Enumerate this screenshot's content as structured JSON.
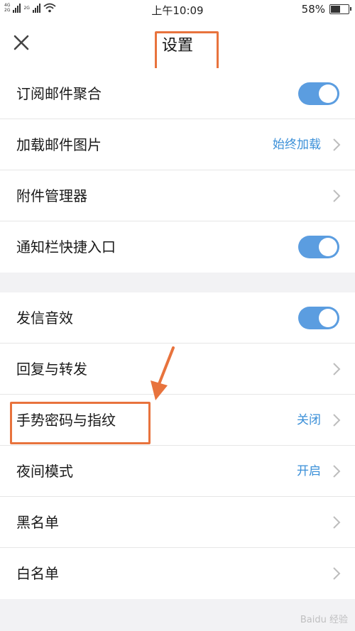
{
  "status_bar": {
    "net1": "4G",
    "net2": "2G",
    "net3": "2G",
    "time": "上午10:09",
    "battery": "58%",
    "battery_level": 0.58
  },
  "header": {
    "title": "设置"
  },
  "rows": [
    {
      "label": "订阅邮件聚合",
      "toggle": true
    },
    {
      "label": "加载邮件图片",
      "value": "始终加载"
    },
    {
      "label": "附件管理器"
    },
    {
      "label": "通知栏快捷入口",
      "toggle": true
    },
    {
      "label": "发信音效",
      "toggle": true
    },
    {
      "label": "回复与转发"
    },
    {
      "label": "手势密码与指纹",
      "value": "关闭"
    },
    {
      "label": "夜间模式",
      "value": "开启"
    },
    {
      "label": "黑名单"
    },
    {
      "label": "白名单"
    }
  ],
  "watermark": "Baidu 经验",
  "colors": {
    "accent": "#5b9de0",
    "value_text": "#3a8fd8",
    "highlight": "#e8733d"
  }
}
